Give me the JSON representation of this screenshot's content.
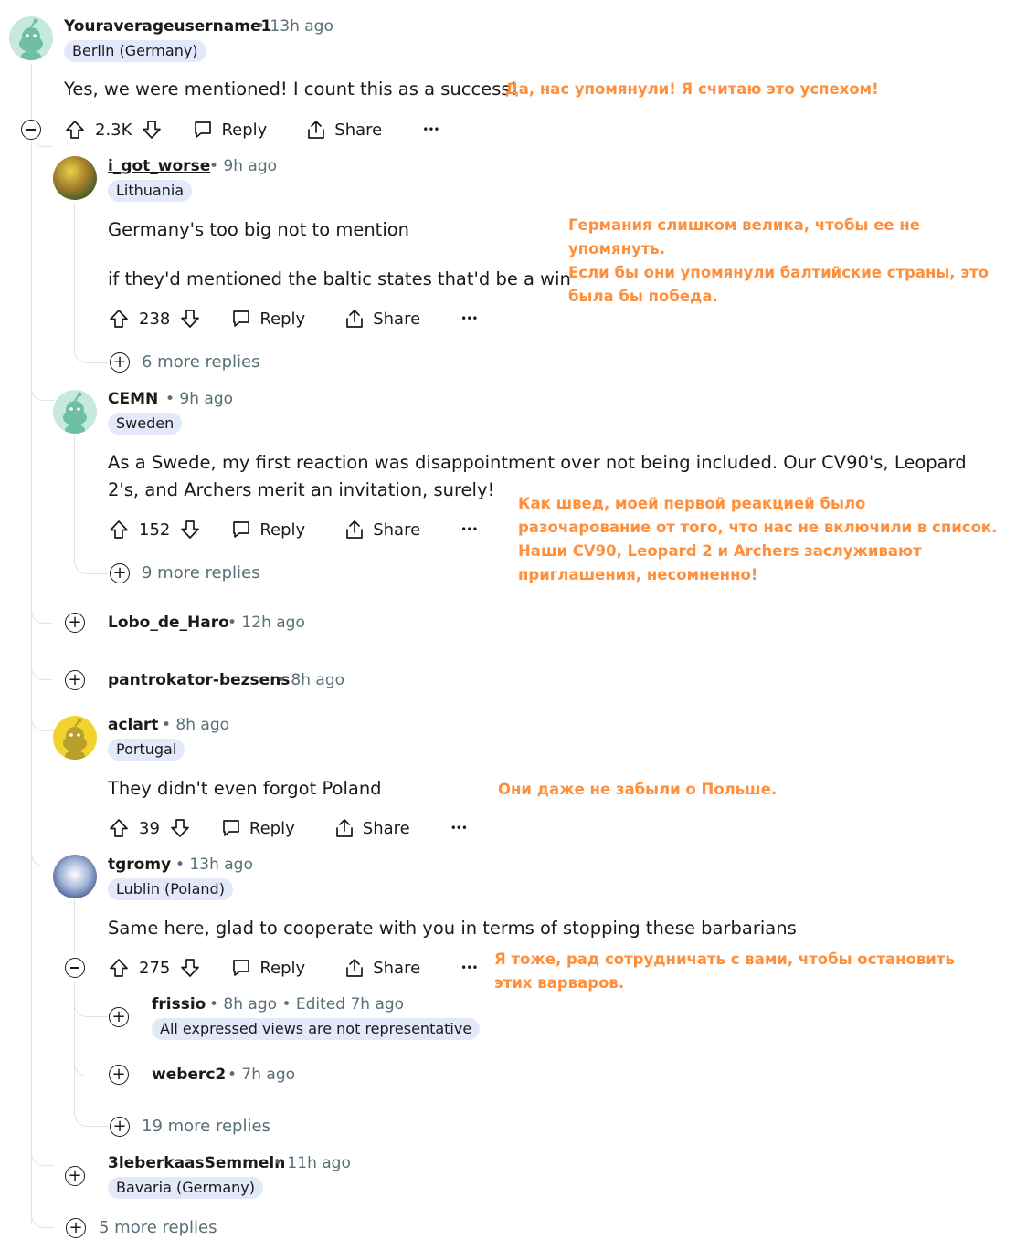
{
  "colors": {
    "annotation": "#ff8f3a",
    "flair_bg": "#e3e9fa",
    "meta": "#576f76"
  },
  "common": {
    "reply": "Reply",
    "share": "Share",
    "more": "•••"
  },
  "c1": {
    "username": "Youraverageusername1",
    "time": "• 13h ago",
    "flair": "Berlin (Germany)",
    "text": "Yes, we were mentioned! I count this as a success!",
    "translation": "Да, нас упомянули! Я считаю это успехом!",
    "score": "2.3K"
  },
  "c2": {
    "username": "i_got_worse",
    "time": "• 9h ago",
    "flair": "Lithuania",
    "text1": "Germany's too big not to mention",
    "text2": "if they'd mentioned the baltic states that'd be a win",
    "translation1": "Германия слишком велика, чтобы ее не упомянуть.",
    "translation2": "Если бы они упомянули балтийские страны, это была бы победа.",
    "score": "238",
    "more_replies": "6 more replies"
  },
  "c3": {
    "username": "CEMN",
    "time": "• 9h ago",
    "flair": "Sweden",
    "text": "As a Swede, my first reaction was disappointment over not being included. Our CV90's, Leopard 2's, and Archers merit an invitation, surely!",
    "translation": "Как швед, моей первой реакцией было разочарование от того, что нас не включили в список. Наши CV90, Leopard 2 и Archers заслуживают приглашения, несомненно!",
    "score": "152",
    "more_replies": "9 more replies"
  },
  "c4": {
    "username": "Lobo_de_Haro",
    "time": "• 12h ago"
  },
  "c5": {
    "username": "pantrokator-bezsens",
    "time": "• 8h ago"
  },
  "c6": {
    "username": "aclart",
    "time": "• 8h ago",
    "flair": "Portugal",
    "text": "They didn't even forgot Poland",
    "translation": "Они даже не забыли о Польше.",
    "score": "39"
  },
  "c7": {
    "username": "tgromy",
    "time": "• 13h ago",
    "flair": "Lublin (Poland)",
    "text": "Same here, glad to cooperate with you in terms of stopping these barbarians",
    "translation": "Я тоже, рад сотрудничать с вами, чтобы остановить этих варваров.",
    "score": "275",
    "more_replies": "19 more replies"
  },
  "c8": {
    "username": "frissio",
    "time": "• 8h ago • Edited 7h ago",
    "flair": "All expressed views are not representative"
  },
  "c9": {
    "username": "weberc2",
    "time": "• 7h ago"
  },
  "c10": {
    "username": "3leberkaasSemmeln",
    "time": "• 11h ago",
    "flair": "Bavaria (Germany)"
  },
  "bottom": {
    "more_replies": "5 more replies"
  }
}
